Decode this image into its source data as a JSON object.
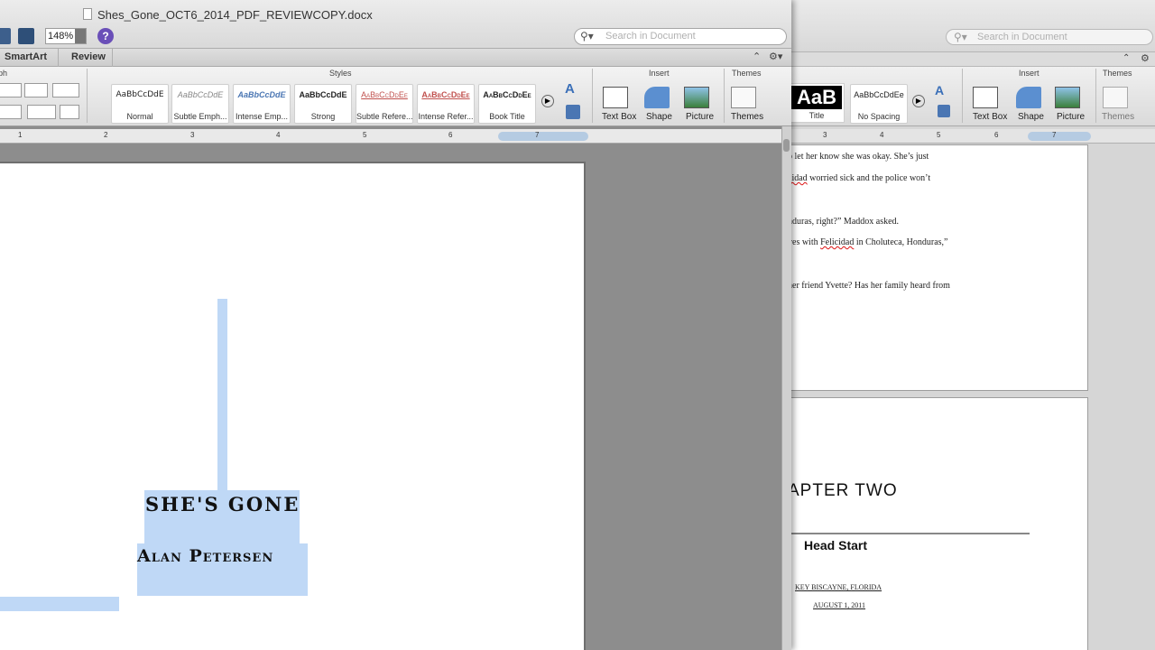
{
  "window_back": {
    "search": {
      "placeholder": "Search in Document"
    },
    "ribbon": {
      "insert_label": "Insert",
      "themes_label": "Themes",
      "style_title_sample": "AaB",
      "style_title": "Title",
      "style_nospacing_sample": "AaBbCcDdEe",
      "style_nospacing": "No Spacing",
      "text_box": "Text Box",
      "shape": "Shape",
      "picture": "Picture",
      "themes": "Themes"
    },
    "ruler": [
      "3",
      "4",
      "5",
      "6",
      "7"
    ],
    "page1_lines": [
      "o let her know she was okay. She’s just",
      "worried sick and the police won’t",
      "nduras, right?” Maddox asked.",
      "ves with",
      "in Choluteca, Honduras,”",
      "her friend Yvette? Has her family heard from"
    ],
    "page1_names": {
      "felicidad_a": "cidad",
      "felicidad_b": "Felicidad"
    },
    "chapter": "APTER TWO",
    "subtitle": "Head Start",
    "location": "KEY BISCAYNE, FLORIDA",
    "date": "AUGUST 1, 2011"
  },
  "window_front": {
    "document_title": "Shes_Gone_OCT6_2014_PDF_REVIEWCOPY.docx",
    "zoom": "148%",
    "help": "?",
    "search": {
      "placeholder": "Search in Document"
    },
    "tabs": {
      "smartart": "SmartArt",
      "review": "Review"
    },
    "ribbon": {
      "paragraph_label": "ph",
      "styles_label": "Styles",
      "insert_label": "Insert",
      "themes_label": "Themes",
      "styles": [
        {
          "sample": "AaBbCcDdE",
          "name": "Normal"
        },
        {
          "sample": "AaBbCcDdE",
          "name": "Subtle Emph..."
        },
        {
          "sample": "AaBbCcDdE",
          "name": "Intense Emp..."
        },
        {
          "sample": "AaBbCcDdE",
          "name": "Strong"
        },
        {
          "sample": "AaBbCcDdEe",
          "name": "Subtle Refere..."
        },
        {
          "sample": "AaBbCcDdEe",
          "name": "Intense Refer..."
        },
        {
          "sample": "AaBbCcDdEe",
          "name": "Book Title"
        }
      ],
      "text_box": "Text Box",
      "shape": "Shape",
      "picture": "Picture",
      "themes": "Themes"
    },
    "ruler": [
      "1",
      "2",
      "3",
      "4",
      "5",
      "6",
      "7"
    ],
    "page": {
      "title": "SHE'S GONE",
      "author": "Alan Petersen"
    }
  },
  "colors": {
    "selection": "#bfd8f6",
    "help_button": "#6a4fb8",
    "ruler_selection": "#b5cbe2"
  }
}
